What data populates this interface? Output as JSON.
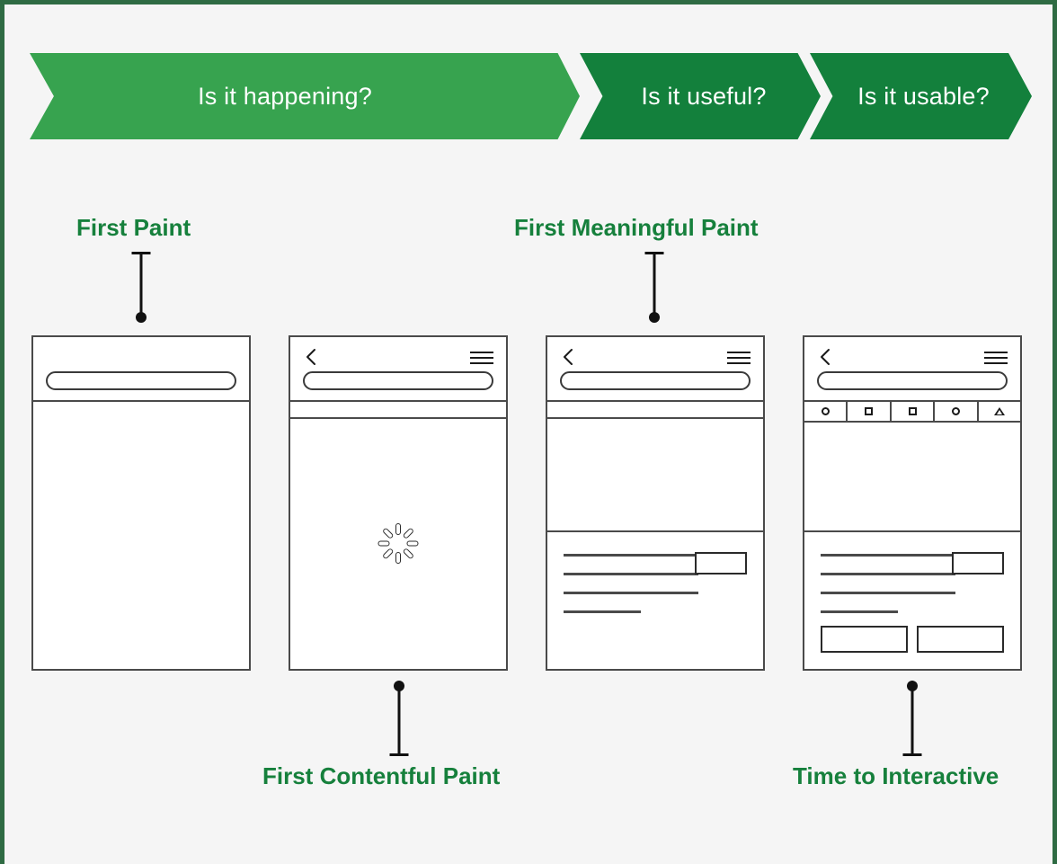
{
  "page": {
    "background_color": "#f5f5f5",
    "border_color": "#2f6b43",
    "accent_green": "#37a34f",
    "accent_green_dark": "#13803c",
    "label_green": "#16803c",
    "wireframe_stroke": "#4a4a4a"
  },
  "banner": {
    "stages": [
      {
        "label": "Is it happening?",
        "color": "#37a34f"
      },
      {
        "label": "Is it useful?",
        "color": "#13803c"
      },
      {
        "label": "Is it usable?",
        "color": "#13803c"
      }
    ]
  },
  "metrics": [
    {
      "key": "fp",
      "label": "First Paint",
      "position": "top",
      "phone": 1
    },
    {
      "key": "fmp",
      "label": "First Meaningful Paint",
      "position": "top",
      "phone": 3
    },
    {
      "key": "fcp",
      "label": "First Contentful Paint",
      "position": "bottom",
      "phone": 2
    },
    {
      "key": "tti",
      "label": "Time to Interactive",
      "position": "bottom",
      "phone": 4
    }
  ],
  "phones": [
    {
      "id": "phone-1",
      "state": "first-paint",
      "chrome": {
        "has_back": false,
        "has_menu": false,
        "has_urlbar": true
      },
      "has_thin_bar": false,
      "has_icon_toolbar": false,
      "content": {
        "spinner": false,
        "text_lines": 0,
        "thumbnail": false,
        "buttons": 0
      }
    },
    {
      "id": "phone-2",
      "state": "first-contentful-paint",
      "chrome": {
        "has_back": true,
        "has_menu": true,
        "has_urlbar": true
      },
      "has_thin_bar": true,
      "has_icon_toolbar": false,
      "content": {
        "spinner": true,
        "text_lines": 0,
        "thumbnail": false,
        "buttons": 0
      }
    },
    {
      "id": "phone-3",
      "state": "first-meaningful-paint",
      "chrome": {
        "has_back": true,
        "has_menu": true,
        "has_urlbar": true
      },
      "has_thin_bar": true,
      "has_icon_toolbar": false,
      "content": {
        "spinner": false,
        "text_lines": 4,
        "thumbnail": true,
        "buttons": 0
      }
    },
    {
      "id": "phone-4",
      "state": "time-to-interactive",
      "chrome": {
        "has_back": true,
        "has_menu": true,
        "has_urlbar": true
      },
      "has_thin_bar": false,
      "has_icon_toolbar": true,
      "icon_toolbar": [
        "circle-icon",
        "square-icon",
        "square-icon",
        "circle-icon",
        "triangle-icon"
      ],
      "content": {
        "spinner": false,
        "text_lines": 4,
        "thumbnail": true,
        "buttons": 2
      }
    }
  ],
  "icons": {
    "back": "chevron-left-icon",
    "menu": "hamburger-menu-icon",
    "urlbar": "address-bar",
    "spinner": "loading-spinner-icon"
  }
}
